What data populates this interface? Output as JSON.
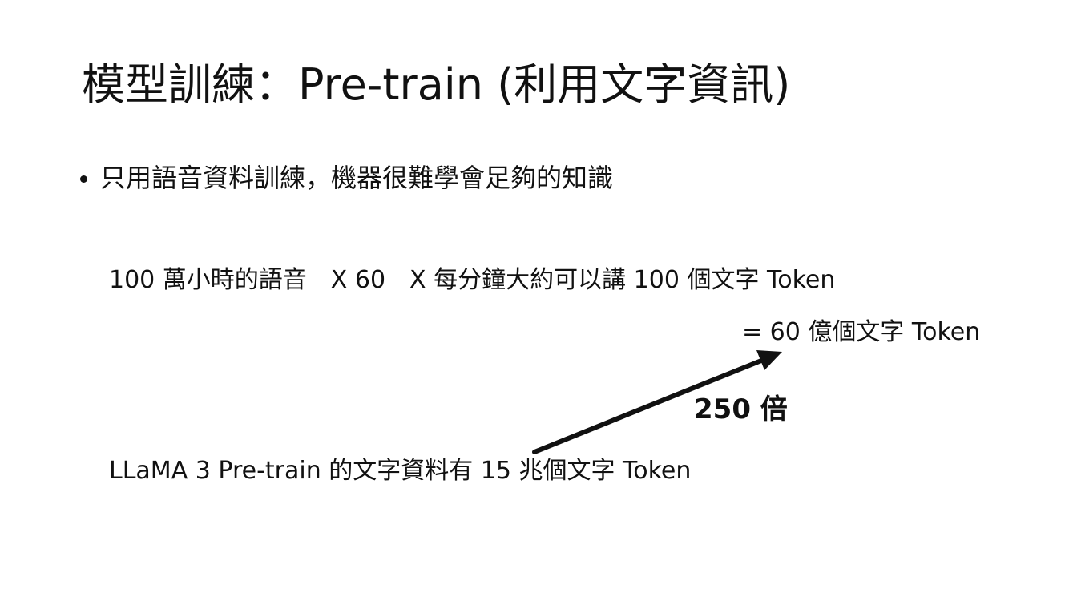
{
  "slide": {
    "title": "模型訓練：Pre-train (利用文字資訊)",
    "bullet": "只用語音資料訓練，機器很難學會足夠的知識",
    "calculation": "100 萬小時的語音　X 60　X 每分鐘大約可以講 100 個文字 Token",
    "result": "= 60 億個文字 Token",
    "factor_label": "250 倍",
    "llama_line": "LLaMA 3 Pre-train 的文字資料有 15 兆個文字 Token"
  }
}
